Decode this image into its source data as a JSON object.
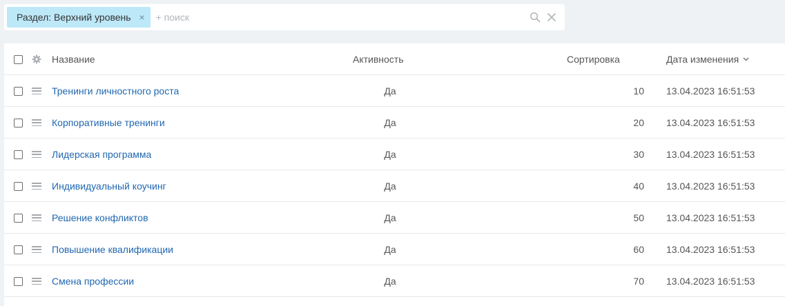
{
  "filter": {
    "chip_label": "Раздел: Верхний уровень",
    "chip_close": "×",
    "search_placeholder": "+ поиск",
    "clear_icon": "close-icon",
    "search_icon": "search-icon"
  },
  "table": {
    "columns": {
      "name": "Название",
      "active": "Активность",
      "sort": "Сортировка",
      "date": "Дата изменения"
    },
    "rows": [
      {
        "name": "Тренинги личностного роста",
        "active": "Да",
        "sort": "10",
        "date": "13.04.2023 16:51:53"
      },
      {
        "name": "Корпоративные тренинги",
        "active": "Да",
        "sort": "20",
        "date": "13.04.2023 16:51:53"
      },
      {
        "name": "Лидерская программа",
        "active": "Да",
        "sort": "30",
        "date": "13.04.2023 16:51:53"
      },
      {
        "name": "Индивидуальный коучинг",
        "active": "Да",
        "sort": "40",
        "date": "13.04.2023 16:51:53"
      },
      {
        "name": "Решение конфликтов",
        "active": "Да",
        "sort": "50",
        "date": "13.04.2023 16:51:53"
      },
      {
        "name": "Повышение квалификации",
        "active": "Да",
        "sort": "60",
        "date": "13.04.2023 16:51:53"
      },
      {
        "name": "Смена профессии",
        "active": "Да",
        "sort": "70",
        "date": "13.04.2023 16:51:53"
      }
    ]
  },
  "colors": {
    "chip_bg": "#bde8f8",
    "link": "#2067b0",
    "page_bg": "#eef2f4"
  }
}
